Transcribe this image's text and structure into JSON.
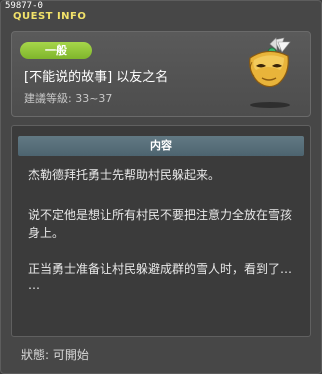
{
  "window": {
    "id_text": "59877-0",
    "title": "QUEST INFO"
  },
  "quest": {
    "category": "一般",
    "name": "[不能说的故事] 以友之名",
    "level": "建議等級: 33~37",
    "icon": "golden-mask-icon"
  },
  "content": {
    "header": "内容",
    "lines": [
      "杰勒德拜托勇士先帮助村民躲起来。",
      "说不定他是想让所有村民不要把注意力全放在雪孩",
      "身上。",
      "正当勇士准备让村民躲避成群的雪人时，看到了…",
      "…"
    ]
  },
  "status": "狀態: 可開始",
  "colors": {
    "title_accent": "#f2e26a",
    "level_pill": "#8dc63f",
    "section_header": "#56707b",
    "background": "#474747"
  }
}
